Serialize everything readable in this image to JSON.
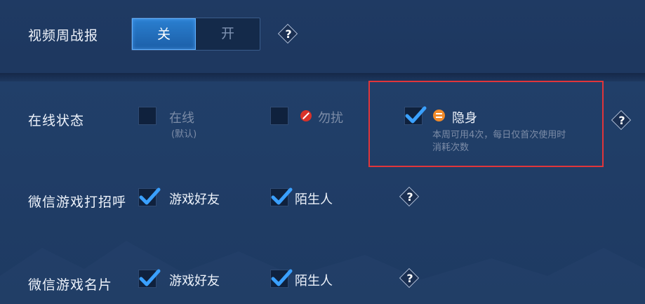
{
  "video_report": {
    "label": "视频周战报",
    "off_label": "关",
    "on_label": "开",
    "selected": "关"
  },
  "online_status": {
    "label": "在线状态",
    "options": [
      {
        "label": "在线",
        "sub": "(默认)",
        "checked": false
      },
      {
        "label": "勿扰",
        "checked": false,
        "icon": "no-disturb-icon"
      },
      {
        "label": "隐身",
        "checked": true,
        "icon": "stealth-icon",
        "desc_line1": "本周可用4次，每日仅首次使用时",
        "desc_line2": "消耗次数"
      }
    ]
  },
  "wechat_greeting": {
    "label": "微信游戏打招呼",
    "options": [
      {
        "label": "游戏好友",
        "checked": true
      },
      {
        "label": "陌生人",
        "checked": true
      }
    ]
  },
  "wechat_card": {
    "label": "微信游戏名片",
    "options": [
      {
        "label": "游戏好友",
        "checked": true
      },
      {
        "label": "陌生人",
        "checked": true
      }
    ]
  },
  "help_glyph": "?",
  "colors": {
    "accent": "#2a7fd0",
    "check": "#3aa0ff",
    "highlight_box": "#e0353a",
    "background": "#1f3a63"
  }
}
